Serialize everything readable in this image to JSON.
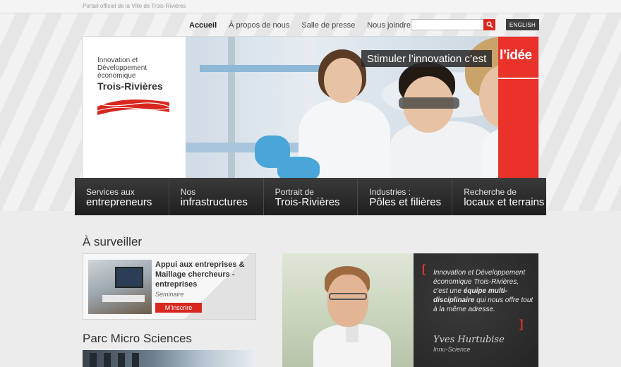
{
  "top_bar": {
    "tagline": "Portail officiel de la Ville de Trois-Rivières"
  },
  "nav": {
    "items": [
      {
        "label": "Accueil",
        "active": true
      },
      {
        "label": "À propos de nous",
        "active": false
      },
      {
        "label": "Salle de presse",
        "active": false
      },
      {
        "label": "Nous joindre",
        "active": false
      }
    ],
    "search_placeholder": "",
    "search_icon": "search-icon",
    "language_button": "ENGLISH"
  },
  "banner": {
    "logo_line1": "Innovation et",
    "logo_line2": "Développement",
    "logo_line3": "économique",
    "logo_city": "Trois-Rivières",
    "slogan": "Stimuler l’innovation c’est",
    "slogan_accent": "l’idée"
  },
  "main_menu": [
    {
      "line1": "Services aux",
      "line2": "entrepreneurs"
    },
    {
      "line1": "Nos",
      "line2": "infrastructures"
    },
    {
      "line1": "Portrait de",
      "line2": "Trois-Rivières"
    },
    {
      "line1": "Industries :",
      "line2": "Pôles et filières"
    },
    {
      "line1": "Recherche de",
      "line2": "locaux et terrains"
    }
  ],
  "watch": {
    "heading": "À surveiller",
    "title": "Appui aux entreprises & Maillage chercheurs - entreprises",
    "type": "Séminaire",
    "button": "M’inscrire"
  },
  "parc": {
    "heading": "Parc Micro Sciences"
  },
  "testimonial": {
    "quote_part1": "Innovation et Développement économique Trois-Rivières, c’est une ",
    "quote_bold": "équipe multi-disciplinaire",
    "quote_part2": " qui nous offre tout à la même adresse.",
    "signature": "Yves Hurtubise",
    "organization": "Innu-Science"
  },
  "colors": {
    "accent_red": "#e8322a",
    "menu_dark": "#2a2a2a",
    "chalkboard": "#2f2f2f"
  }
}
